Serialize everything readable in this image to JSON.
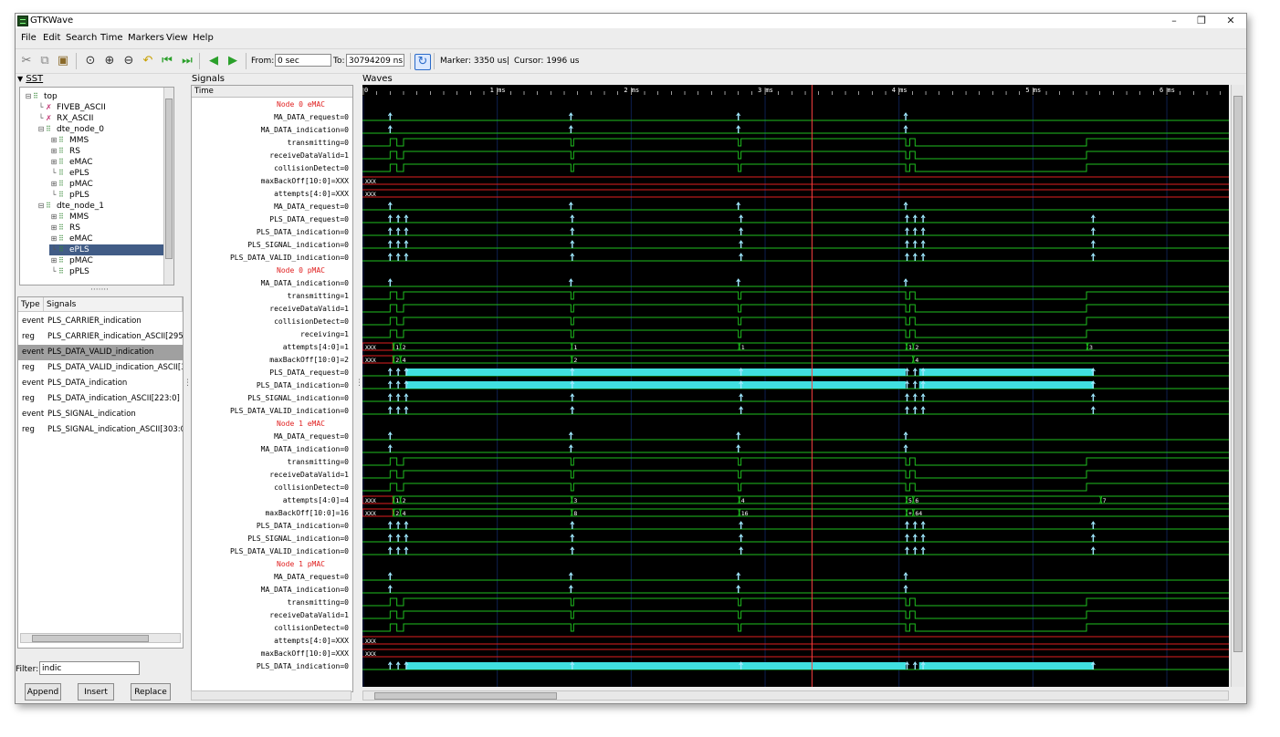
{
  "window": {
    "title": "GTKWave",
    "minimize": "–",
    "maximize": "❐",
    "close": "✕"
  },
  "menus": [
    "File",
    "Edit",
    "Search",
    "Time",
    "Markers",
    "View",
    "Help"
  ],
  "toolbar": {
    "icons": [
      "cut-icon",
      "copy-icon",
      "paste-icon",
      "zoom-fit-icon",
      "zoom-in-icon",
      "zoom-out-icon",
      "undo-zoom-icon",
      "jump-start-icon",
      "jump-end-icon",
      "prev-edge-icon",
      "next-edge-icon",
      "reload-icon"
    ],
    "from_label": "From:",
    "from_value": "0 sec",
    "to_label": "To:",
    "to_value": "30794209 ns",
    "marker_text": "Marker: 3350 us",
    "separator": "|",
    "cursor_text": "Cursor: 1996 us"
  },
  "sst": {
    "label": "SST",
    "tree": [
      {
        "label": "top",
        "depth": 0,
        "type": "module",
        "toggle": "⊟"
      },
      {
        "label": "FIVEB_ASCII",
        "depth": 1,
        "type": "var",
        "toggle": ""
      },
      {
        "label": "RX_ASCII",
        "depth": 1,
        "type": "var",
        "toggle": ""
      },
      {
        "label": "dte_node_0",
        "depth": 1,
        "type": "module",
        "toggle": "⊟"
      },
      {
        "label": "MMS",
        "depth": 2,
        "type": "module",
        "toggle": "⊞"
      },
      {
        "label": "RS",
        "depth": 2,
        "type": "module",
        "toggle": "⊞"
      },
      {
        "label": "eMAC",
        "depth": 2,
        "type": "module",
        "toggle": "⊞"
      },
      {
        "label": "ePLS",
        "depth": 2,
        "type": "module",
        "toggle": ""
      },
      {
        "label": "pMAC",
        "depth": 2,
        "type": "module",
        "toggle": "⊞"
      },
      {
        "label": "pPLS",
        "depth": 2,
        "type": "module",
        "toggle": ""
      },
      {
        "label": "dte_node_1",
        "depth": 1,
        "type": "module",
        "toggle": "⊟"
      },
      {
        "label": "MMS",
        "depth": 2,
        "type": "module",
        "toggle": "⊞"
      },
      {
        "label": "RS",
        "depth": 2,
        "type": "module",
        "toggle": "⊞"
      },
      {
        "label": "eMAC",
        "depth": 2,
        "type": "module",
        "toggle": "⊞"
      },
      {
        "label": "ePLS",
        "depth": 2,
        "type": "module",
        "toggle": "",
        "selected": true
      },
      {
        "label": "pMAC",
        "depth": 2,
        "type": "module",
        "toggle": "⊞"
      },
      {
        "label": "pPLS",
        "depth": 2,
        "type": "module",
        "toggle": ""
      }
    ]
  },
  "signal_list": {
    "col_type": "Type",
    "col_signals": "Signals",
    "rows": [
      {
        "type": "event",
        "name": "PLS_CARRIER_indication"
      },
      {
        "type": "reg",
        "name": "PLS_CARRIER_indication_ASCII[295:"
      },
      {
        "type": "event",
        "name": "PLS_DATA_VALID_indication",
        "selected": true
      },
      {
        "type": "reg",
        "name": "PLS_DATA_VALID_indication_ASCII[3"
      },
      {
        "type": "event",
        "name": "PLS_DATA_indication"
      },
      {
        "type": "reg",
        "name": "PLS_DATA_indication_ASCII[223:0]"
      },
      {
        "type": "event",
        "name": "PLS_SIGNAL_indication"
      },
      {
        "type": "reg",
        "name": "PLS_SIGNAL_indication_ASCII[303:0]"
      }
    ]
  },
  "filter": {
    "label": "Filter:",
    "value": "indic"
  },
  "buttons": {
    "append": "Append",
    "insert": "Insert",
    "replace": "Replace"
  },
  "signals_pane": {
    "label": "Signals",
    "time_header": "Time",
    "rows": [
      {
        "text": "Node 0 eMAC",
        "header": true
      },
      {
        "text": "MA_DATA_request=0"
      },
      {
        "text": "MA_DATA_indication=0"
      },
      {
        "text": "transmitting=0"
      },
      {
        "text": "receiveDataValid=1"
      },
      {
        "text": "collisionDetect=0"
      },
      {
        "text": "maxBackOff[10:0]=XXX"
      },
      {
        "text": "attempts[4:0]=XXX"
      },
      {
        "text": "MA_DATA_request=0"
      },
      {
        "text": "PLS_DATA_request=0"
      },
      {
        "text": "PLS_DATA_indication=0"
      },
      {
        "text": "PLS_SIGNAL_indication=0"
      },
      {
        "text": "PLS_DATA_VALID_indication=0"
      },
      {
        "text": "Node 0 pMAC",
        "header": true
      },
      {
        "text": "MA_DATA_indication=0"
      },
      {
        "text": "transmitting=1"
      },
      {
        "text": "receiveDataValid=1"
      },
      {
        "text": "collisionDetect=0"
      },
      {
        "text": "receiving=1"
      },
      {
        "text": "attempts[4:0]=1"
      },
      {
        "text": "maxBackOff[10:0]=2"
      },
      {
        "text": "PLS_DATA_request=0"
      },
      {
        "text": "PLS_DATA_indication=0"
      },
      {
        "text": "PLS_SIGNAL_indication=0"
      },
      {
        "text": "PLS_DATA_VALID_indication=0"
      },
      {
        "text": "Node 1 eMAC",
        "header": true
      },
      {
        "text": "MA_DATA_request=0"
      },
      {
        "text": "MA_DATA_indication=0"
      },
      {
        "text": "transmitting=0"
      },
      {
        "text": "receiveDataValid=1"
      },
      {
        "text": "collisionDetect=0"
      },
      {
        "text": "attempts[4:0]=4"
      },
      {
        "text": "maxBackOff[10:0]=16"
      },
      {
        "text": "PLS_DATA_indication=0"
      },
      {
        "text": "PLS_SIGNAL_indication=0"
      },
      {
        "text": "PLS_DATA_VALID_indication=0"
      },
      {
        "text": "Node 1 pMAC",
        "header": true
      },
      {
        "text": "MA_DATA_request=0"
      },
      {
        "text": "MA_DATA_indication=0"
      },
      {
        "text": "transmitting=0"
      },
      {
        "text": "receiveDataValid=1"
      },
      {
        "text": "collisionDetect=0"
      },
      {
        "text": "attempts[4:0]=XXX"
      },
      {
        "text": "maxBackOff[10:0]=XXX"
      },
      {
        "text": "PLS_DATA_indication=0"
      }
    ]
  },
  "waves": {
    "label": "Waves",
    "time_ticks": [
      {
        "label": "0",
        "t_ms": 0
      },
      {
        "label": "1 ms",
        "t_ms": 1
      },
      {
        "label": "2 ms",
        "t_ms": 2
      },
      {
        "label": "3 ms",
        "t_ms": 3
      },
      {
        "label": "4 ms",
        "t_ms": 4
      },
      {
        "label": "5 ms",
        "t_ms": 5
      },
      {
        "label": "6 ms",
        "t_ms": 6
      }
    ],
    "visible_ms": 6.47,
    "marker_ms": 3.35,
    "colors": {
      "background": "#000000",
      "grid": "#0d1f4f",
      "wave": "#1fbf1f",
      "xval": "#e02020",
      "event": "#9fe8ff",
      "bus_fill": "#40e0e0",
      "marker": "#ff4040",
      "ticks": "#ffffff"
    },
    "bus_values": [
      {
        "row": 19,
        "values": [
          {
            "t": 0.22,
            "v": "1"
          },
          {
            "t": 0.27,
            "v": "2"
          },
          {
            "t": 1.55,
            "v": "1"
          },
          {
            "t": 2.8,
            "v": "1"
          },
          {
            "t": 4.05,
            "v": "1"
          },
          {
            "t": 4.1,
            "v": "2"
          },
          {
            "t": 5.4,
            "v": "3"
          }
        ]
      },
      {
        "row": 20,
        "values": [
          {
            "t": 0.22,
            "v": "2"
          },
          {
            "t": 0.27,
            "v": "4"
          },
          {
            "t": 1.55,
            "v": "2"
          },
          {
            "t": 4.1,
            "v": "4"
          }
        ]
      },
      {
        "row": 31,
        "values": [
          {
            "t": 0.22,
            "v": "1"
          },
          {
            "t": 0.27,
            "v": "2"
          },
          {
            "t": 1.55,
            "v": "3"
          },
          {
            "t": 2.8,
            "v": "4"
          },
          {
            "t": 4.05,
            "v": "5"
          },
          {
            "t": 4.1,
            "v": "6"
          },
          {
            "t": 5.5,
            "v": "7"
          }
        ]
      },
      {
        "row": 32,
        "values": [
          {
            "t": 0.22,
            "v": "2"
          },
          {
            "t": 0.27,
            "v": "4"
          },
          {
            "t": 1.55,
            "v": "8"
          },
          {
            "t": 2.8,
            "v": "16"
          },
          {
            "t": 4.05,
            "v": "+"
          },
          {
            "t": 4.1,
            "v": "64"
          }
        ]
      }
    ],
    "xxx_label": "XXX"
  }
}
